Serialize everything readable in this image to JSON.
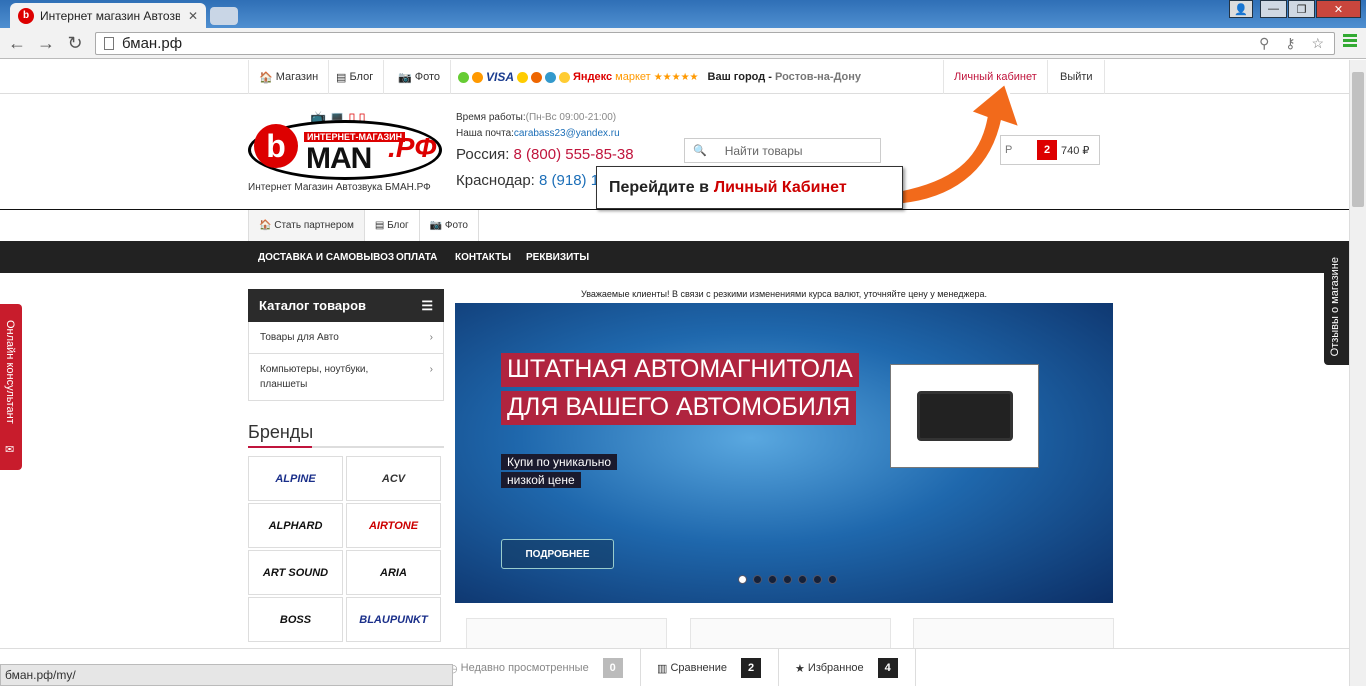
{
  "browser": {
    "tab_title": "Интернет магазин Автозв",
    "tab_favicon": "b",
    "tab_close": "✕",
    "url": "бман.рф",
    "status_url": "бман.рф/my/"
  },
  "topbar": {
    "shop": "Магазин",
    "blog": "Блог",
    "photo": "Фото",
    "visa": "VISA",
    "yandex": "Яндекс",
    "market": "маркет",
    "stars": "★★★★★",
    "city_label": "Ваш город - ",
    "city": "Ростов-на-Дону",
    "account": "Личный кабинет",
    "logout": "Выйти"
  },
  "logo": {
    "small": "ИНТЕРНЕТ-МАГАЗИН",
    "man": "MAN",
    "rf": ".РФ",
    "b": "b",
    "caption": "Интернет Магазин Автозвука БМАН.РФ"
  },
  "contacts": {
    "hours_label": "Время работы:",
    "hours": "(Пн-Вс 09:00-21:00)",
    "mail_label": "Наша почта:",
    "mail": "carabass23@yandex.ru",
    "russia_label": "Россия: ",
    "russia_phone": "8 (800) 555-85-38",
    "krasnodar_label": "Краснодар: ",
    "krasnodar_phone": "8 (918) 1"
  },
  "search": {
    "placeholder": "Найти товары"
  },
  "cart": {
    "label": "Р",
    "count": "2",
    "sum": "740 ₽"
  },
  "subnav": {
    "partner": "Стать партнером",
    "blog": "Блог",
    "photo": "Фото"
  },
  "mainnav": [
    "ДОСТАВКА И САМОВЫВОЗ",
    "ОПЛАТА",
    "КОНТАКТЫ",
    "РЕКВИЗИТЫ"
  ],
  "catalog": {
    "title": "Каталог товаров",
    "items": [
      "Товары для Авто",
      "Компьютеры, ноутбуки, планшеты"
    ]
  },
  "brands": {
    "title": "Бренды",
    "list": [
      "ALPINE",
      "ACV",
      "ALPHARD",
      "AIRTONE",
      "ART SOUND",
      "ARIA",
      "BOSS",
      "BLAUPUNKT"
    ]
  },
  "notice": "Уважаемые клиенты! В связи с резкими изменениями курса валют, уточняйте цену у менеджера.",
  "banner": {
    "line1": "ШТАТНАЯ АВТОМАГНИТОЛА",
    "line2": "ДЛЯ ВАШЕГО АВТОМОБИЛЯ",
    "sub1": "Купи по уникально",
    "sub2": "низкой цене",
    "button": "ПОДРОБНЕЕ",
    "slides": 7,
    "active_slide": 1
  },
  "callout": {
    "prefix": "Перейдите в",
    "highlight": "Личный Кабинет"
  },
  "side_tabs": {
    "left": "Онлайн консультант",
    "right": "Отзывы о магазине"
  },
  "bottombar": {
    "recent": "Недавно просмотренные",
    "recent_count": "0",
    "compare": "Сравнение",
    "compare_count": "2",
    "favorites": "Избранное",
    "favorites_count": "4"
  },
  "colors": {
    "accent_red": "#c0143c",
    "nav_dark": "#222222",
    "link_blue": "#1d6fb8",
    "arrow_orange": "#f26a1b"
  }
}
